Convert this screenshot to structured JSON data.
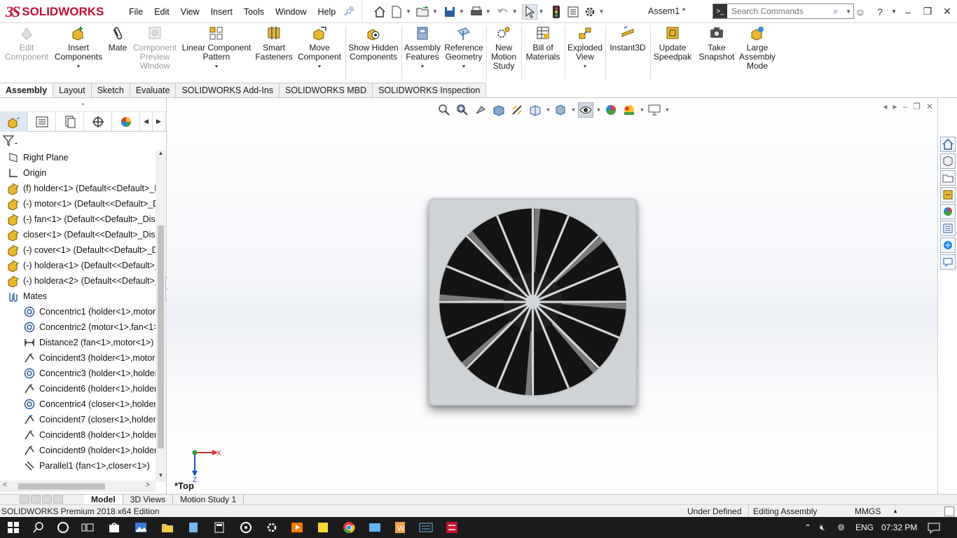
{
  "app": {
    "logo_mark": "3S",
    "logo_text": "SOLIDWORKS",
    "doc_title": "Assem1 *"
  },
  "menu": [
    "File",
    "Edit",
    "View",
    "Insert",
    "Tools",
    "Window",
    "Help"
  ],
  "search": {
    "placeholder": "Search Commands"
  },
  "ribbon": {
    "edit_component": "Edit Component",
    "insert_components": "Insert Components",
    "mate": "Mate",
    "component_preview": "Component Preview Window",
    "linear_pattern": "Linear Component Pattern",
    "smart_fasteners": "Smart Fasteners",
    "move_component": "Move Component",
    "show_hidden": "Show Hidden Components",
    "assembly_features": "Assembly Features",
    "reference_geometry": "Reference Geometry",
    "new_motion_study": "New Motion Study",
    "bill_of_materials": "Bill of Materials",
    "exploded_view": "Exploded View",
    "instant3d": "Instant3D",
    "update_speedpak": "Update Speedpak",
    "take_snapshot": "Take Snapshot",
    "large_assembly": "Large Assembly Mode"
  },
  "tabs": [
    "Assembly",
    "Layout",
    "Sketch",
    "Evaluate",
    "SOLIDWORKS Add-Ins",
    "SOLIDWORKS MBD",
    "SOLIDWORKS Inspection"
  ],
  "tree": [
    {
      "label": "Right Plane",
      "icon": "plane-icon",
      "level": 1
    },
    {
      "label": "Origin",
      "icon": "origin-icon",
      "level": 1
    },
    {
      "label": "(f) holder<1> (Default<<Default>_D",
      "icon": "part-icon",
      "level": 1
    },
    {
      "label": "(-) motor<1> (Default<<Default>_D",
      "icon": "part-icon",
      "level": 1
    },
    {
      "label": "(-) fan<1> (Default<<Default>_Disp",
      "icon": "part-icon",
      "level": 1
    },
    {
      "label": "closer<1> (Default<<Default>_Disp",
      "icon": "part-icon",
      "level": 1
    },
    {
      "label": "(-) cover<1> (Default<<Default>_D",
      "icon": "part-icon",
      "level": 1
    },
    {
      "label": "(-) holdera<1> (Default<<Default>_",
      "icon": "part-icon",
      "level": 1
    },
    {
      "label": "(-) holdera<2> (Default<<Default>_",
      "icon": "part-icon",
      "level": 1
    },
    {
      "label": "Mates",
      "icon": "mates-icon",
      "level": 1
    },
    {
      "label": "Concentric1 (holder<1>,motor",
      "icon": "concentric-icon",
      "level": 2
    },
    {
      "label": "Concentric2 (motor<1>,fan<1>",
      "icon": "concentric-icon",
      "level": 2
    },
    {
      "label": "Distance2 (fan<1>,motor<1>)",
      "icon": "distance-icon",
      "level": 2
    },
    {
      "label": "Coincident3 (holder<1>,motor",
      "icon": "coincident-icon",
      "level": 2
    },
    {
      "label": "Concentric3 (holder<1>,holder",
      "icon": "concentric-icon",
      "level": 2
    },
    {
      "label": "Coincident6 (holder<1>,holder",
      "icon": "coincident-icon",
      "level": 2
    },
    {
      "label": "Concentric4 (closer<1>,holdera",
      "icon": "concentric-icon",
      "level": 2
    },
    {
      "label": "Coincident7 (closer<1>,holdera",
      "icon": "coincident-icon",
      "level": 2
    },
    {
      "label": "Coincident8 (holder<1>,holder",
      "icon": "coincident-icon",
      "level": 2
    },
    {
      "label": "Coincident9 (holder<1>,holder",
      "icon": "coincident-icon",
      "level": 2
    },
    {
      "label": "Parallel1 (fan<1>,closer<1>)",
      "icon": "parallel-icon",
      "level": 2
    }
  ],
  "viewport": {
    "view_label": "*Top",
    "triad_x": "X",
    "triad_z": "Z"
  },
  "bottom_tabs": [
    "Model",
    "3D Views",
    "Motion Study 1"
  ],
  "status": {
    "edition": "SOLIDWORKS Premium 2018 x64 Edition",
    "state": "Under Defined",
    "mode": "Editing Assembly",
    "units": "MMGS"
  },
  "taskbar": {
    "lang": "ENG",
    "time": "07:32 PM"
  },
  "colors": {
    "accent": "#c8102e",
    "selection": "#dfe8f3",
    "fan_blade": "#141414",
    "housing": "#cfd3d6"
  }
}
